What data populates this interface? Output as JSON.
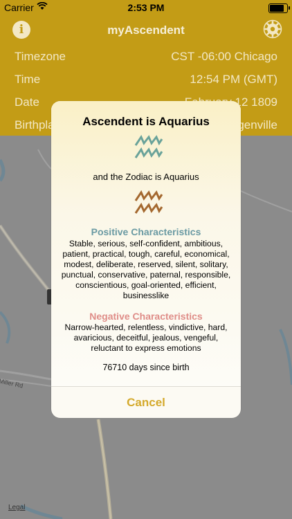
{
  "status": {
    "carrier": "Carrier",
    "time": "2:53 PM",
    "battery_level": 0.92
  },
  "nav": {
    "title": "myAscendent",
    "left_icon": "info-icon",
    "right_icon": "settings-icon"
  },
  "info": {
    "rows": [
      {
        "label": "Timezone",
        "value": "CST -06:00 Chicago"
      },
      {
        "label": "Time",
        "value": "12:54 PM (GMT)"
      },
      {
        "label": "Date",
        "value": "February 12 1809"
      },
      {
        "label": "Birthplace",
        "value": "Hodgenville"
      }
    ]
  },
  "map": {
    "road_label": "Miller Rd",
    "legal": "Legal"
  },
  "dialog": {
    "title": "Ascendent is Aquarius",
    "zodiac_text": "and the Zodiac is Aquarius",
    "positive_heading": "Positive Characteristics",
    "positive_text": "Stable, serious, self-confident, ambitious, patient, practical, tough, careful, economical, modest, deliberate, reserved, silent, solitary, punctual, conservative, paternal, responsible, conscientious, goal-oriented, efficient, businesslike",
    "negative_heading": "Negative Characteristics",
    "negative_text": "Narrow-hearted, relentless, vindictive, hard, avaricious, deceitful, jealous, vengeful, reluctant to express emotions",
    "days_text": "76710 days since birth",
    "cancel_label": "Cancel",
    "ascendent_sign_icon": "aquarius-icon",
    "zodiac_sign_icon": "aquarius-icon"
  },
  "colors": {
    "brand": "#c39c16",
    "ascendent_glyph": "#6aa39a",
    "zodiac_glyph": "#a4682f",
    "positive": "#6a9aa3",
    "negative": "#df8d88",
    "cancel": "#d4a92b"
  }
}
